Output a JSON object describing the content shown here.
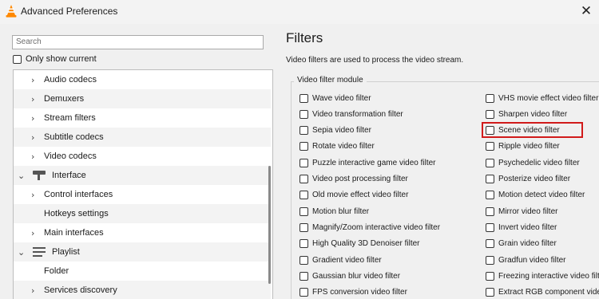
{
  "window": {
    "title": "Advanced Preferences",
    "close_glyph": "✕",
    "app_icon": "vlc-cone-icon"
  },
  "left": {
    "search_placeholder": "Search",
    "only_show_current": "Only show current",
    "tree": [
      {
        "label": "Audio codecs",
        "level": 1,
        "expanded": false
      },
      {
        "label": "Demuxers",
        "level": 1,
        "expanded": false
      },
      {
        "label": "Stream filters",
        "level": 1,
        "expanded": false
      },
      {
        "label": "Subtitle codecs",
        "level": 1,
        "expanded": false
      },
      {
        "label": "Video codecs",
        "level": 1,
        "expanded": false
      },
      {
        "label": "Interface",
        "level": 0,
        "expanded": true,
        "icon": "interface-icon"
      },
      {
        "label": "Control interfaces",
        "level": 1,
        "expanded": false
      },
      {
        "label": "Hotkeys settings",
        "level": 1,
        "leaf": true
      },
      {
        "label": "Main interfaces",
        "level": 1,
        "expanded": false
      },
      {
        "label": "Playlist",
        "level": 0,
        "expanded": true,
        "icon": "playlist-icon"
      },
      {
        "label": "Folder",
        "level": 1,
        "leaf": true
      },
      {
        "label": "Services discovery",
        "level": 1,
        "expanded": false
      }
    ]
  },
  "right": {
    "title": "Filters",
    "description": "Video filters are used to process the video stream.",
    "group_label": "Video filter module",
    "col1": [
      "Wave video filter",
      "Video transformation filter",
      "Sepia video filter",
      "Rotate video filter",
      "Puzzle interactive game video filter",
      "Video post processing filter",
      "Old movie effect video filter",
      "Motion blur filter",
      "Magnify/Zoom interactive video filter",
      "High Quality 3D Denoiser filter",
      "Gradient video filter",
      "Gaussian blur video filter",
      "FPS conversion video filter"
    ],
    "col2": [
      "VHS movie effect video filter",
      "Sharpen video filter",
      "Scene video filter",
      "Ripple video filter",
      "Psychedelic video filter",
      "Posterize video filter",
      "Motion detect video filter",
      "Mirror video filter",
      "Invert video filter",
      "Grain video filter",
      "Gradfun video filter",
      "Freezing interactive video filte",
      "Extract RGB component video"
    ],
    "highlighted": "Scene video filter",
    "highlight_color": "#d11b1b"
  }
}
